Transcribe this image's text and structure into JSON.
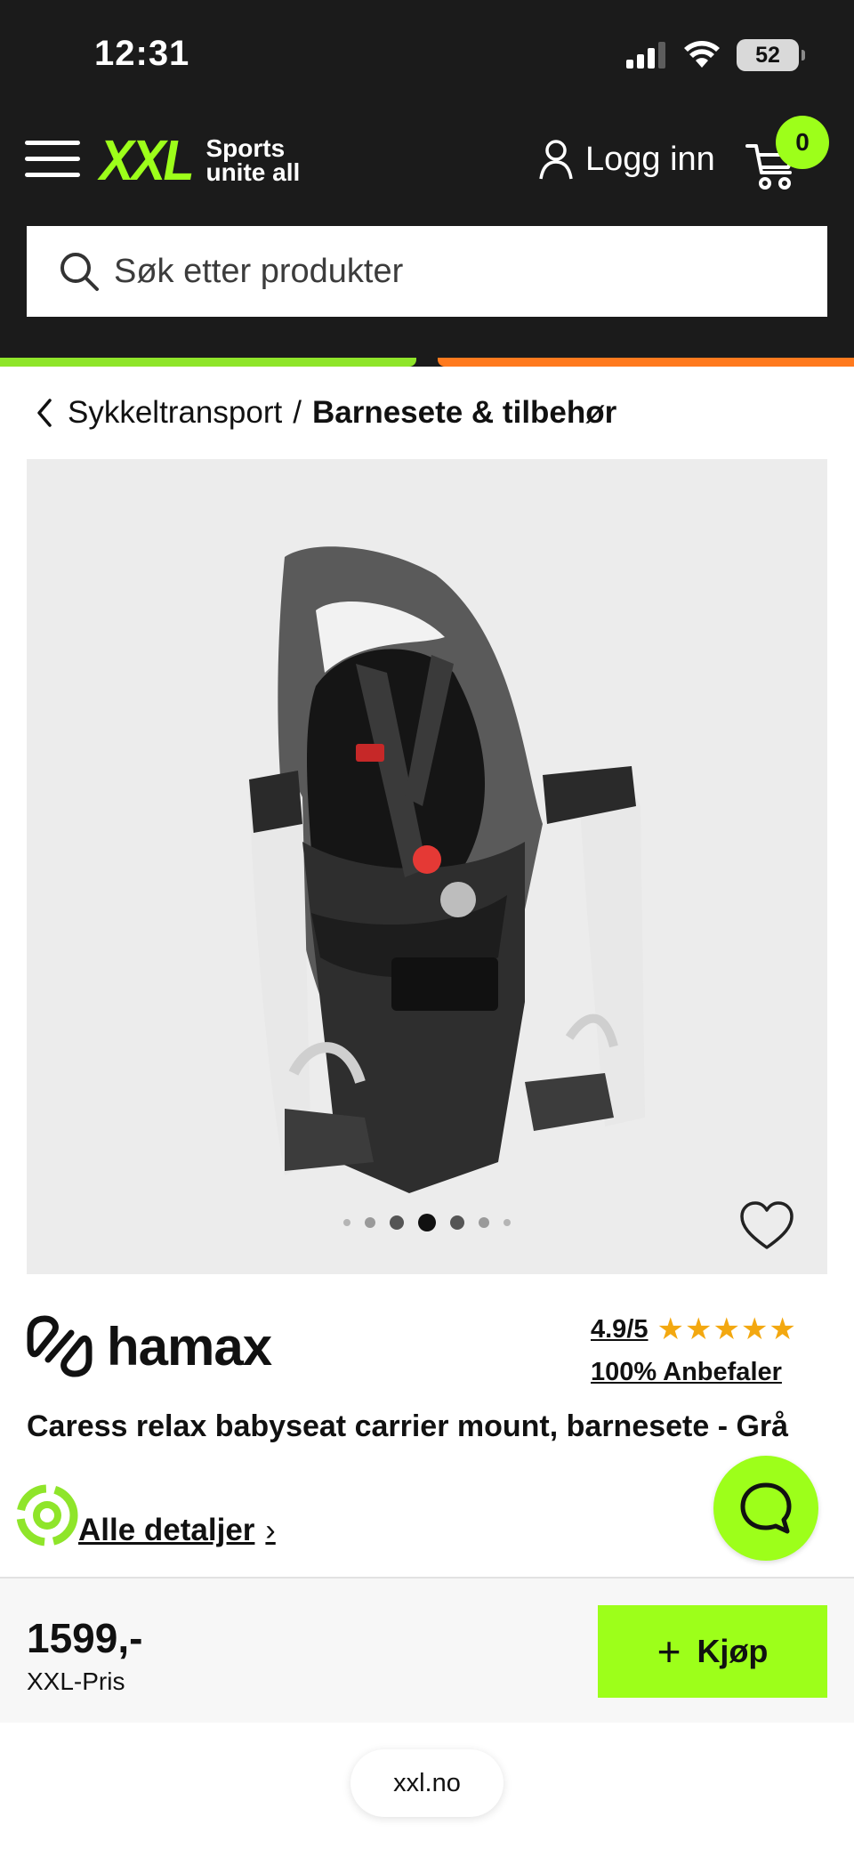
{
  "status_bar": {
    "time": "12:31",
    "battery": "52"
  },
  "header": {
    "logo_text": "XXL",
    "logo_tagline_1": "Sports",
    "logo_tagline_2": "unite all",
    "login_label": "Logg inn",
    "cart_count": "0",
    "brand_color": "#9dff1a"
  },
  "search": {
    "placeholder": "Søk etter produkter"
  },
  "breadcrumb": {
    "parent": "Sykkeltransport",
    "separator": "/",
    "current": "Barnesete & tilbehør"
  },
  "gallery": {
    "image_count": 7,
    "active_index": 3
  },
  "product": {
    "brand": "hamax",
    "rating": "4.9/5",
    "recommend": "100% Anbefaler",
    "stars": "★★★★★",
    "title": "Caress relax babyseat carrier mount, barnesete - Grå",
    "details_link": "Alle detaljer"
  },
  "buy": {
    "price": "1599,-",
    "price_label": "XXL-Pris",
    "button_label": "Kjøp"
  },
  "browser": {
    "url": "xxl.no"
  }
}
